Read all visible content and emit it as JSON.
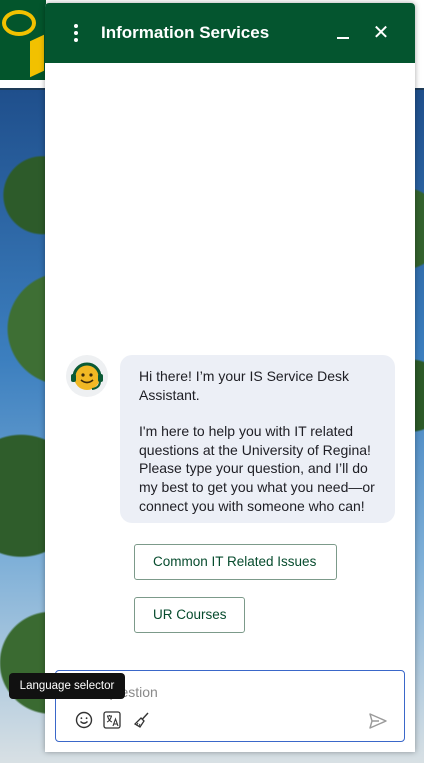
{
  "header": {
    "title": "Information Services",
    "menu_icon": "kebab-menu-icon",
    "minimize_icon": "minimize-icon",
    "close_icon": "close-icon",
    "close_glyph": "✕",
    "background": "#04552f"
  },
  "conversation": {
    "assistant_avatar_icon": "headset-smiley-icon",
    "message_paragraphs": [
      "Hi there! I’m your IS Service Desk Assistant.",
      "I'm here to help you with IT related questions at the University of Regina! Please type your question, and I’ll do my best to get you what you need—or connect you with someone who can!"
    ],
    "quick_replies": [
      "Common IT Related Issues",
      "UR Courses"
    ]
  },
  "composer": {
    "placeholder": "Ask a question",
    "tools": [
      "emoji-icon",
      "translate-icon",
      "broom-icon"
    ],
    "send_icon": "send-icon",
    "tooltip": "Language selector"
  },
  "colors": {
    "brand_green": "#04552f",
    "brand_gold": "#f2c100",
    "bubble_bg": "#eceff6",
    "input_border": "#3a67c9"
  }
}
